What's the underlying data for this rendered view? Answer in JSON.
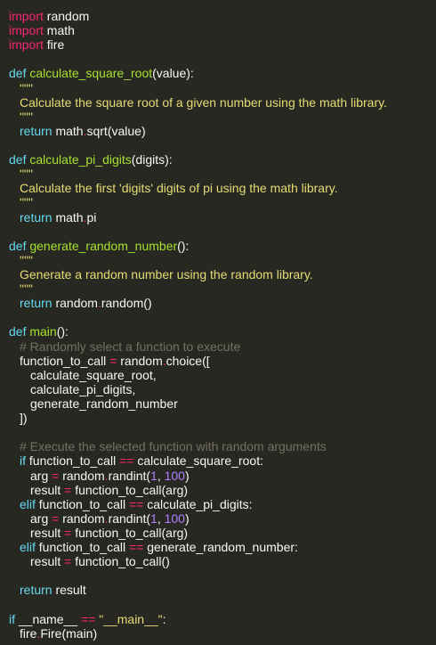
{
  "colors": {
    "background": "#272822",
    "keyword": "#f92672",
    "builtin": "#66d9ef",
    "function": "#a6e22e",
    "string": "#e6db74",
    "comment": "#75715e",
    "number": "#ae81ff",
    "text": "#f8f8f2"
  },
  "lines": [
    {
      "indent": 0,
      "tokens": [
        [
          "k",
          "import"
        ],
        [
          "p",
          " random"
        ]
      ]
    },
    {
      "indent": 0,
      "tokens": [
        [
          "k",
          "import"
        ],
        [
          "p",
          " math"
        ]
      ]
    },
    {
      "indent": 0,
      "tokens": [
        [
          "k",
          "import"
        ],
        [
          "p",
          " fire"
        ]
      ]
    },
    {
      "indent": 0,
      "tokens": []
    },
    {
      "indent": 0,
      "tokens": [
        [
          "b",
          "def"
        ],
        [
          "f",
          " calculate_square_root"
        ],
        [
          "p",
          "(value):"
        ]
      ]
    },
    {
      "indent": 1,
      "tokens": [
        [
          "s",
          "\"\"\""
        ]
      ]
    },
    {
      "indent": 1,
      "tokens": [
        [
          "s",
          "Calculate the square root of a given number using the math library."
        ]
      ]
    },
    {
      "indent": 1,
      "tokens": [
        [
          "s",
          "\"\"\""
        ]
      ]
    },
    {
      "indent": 1,
      "tokens": [
        [
          "b",
          "return"
        ],
        [
          "p",
          " math"
        ],
        [
          "o",
          "."
        ],
        [
          "p",
          "sqrt(value)"
        ]
      ]
    },
    {
      "indent": 0,
      "tokens": []
    },
    {
      "indent": 0,
      "tokens": [
        [
          "b",
          "def"
        ],
        [
          "f",
          " calculate_pi_digits"
        ],
        [
          "p",
          "(digits):"
        ]
      ]
    },
    {
      "indent": 1,
      "tokens": [
        [
          "s",
          "\"\"\""
        ]
      ]
    },
    {
      "indent": 1,
      "tokens": [
        [
          "s",
          "Calculate the first 'digits' digits of pi using the math library."
        ]
      ]
    },
    {
      "indent": 1,
      "tokens": [
        [
          "s",
          "\"\"\""
        ]
      ]
    },
    {
      "indent": 1,
      "tokens": [
        [
          "b",
          "return"
        ],
        [
          "p",
          " math"
        ],
        [
          "o",
          "."
        ],
        [
          "p",
          "pi"
        ]
      ]
    },
    {
      "indent": 0,
      "tokens": []
    },
    {
      "indent": 0,
      "tokens": [
        [
          "b",
          "def"
        ],
        [
          "f",
          " generate_random_number"
        ],
        [
          "p",
          "():"
        ]
      ]
    },
    {
      "indent": 1,
      "tokens": [
        [
          "s",
          "\"\"\""
        ]
      ]
    },
    {
      "indent": 1,
      "tokens": [
        [
          "s",
          "Generate a random number using the random library."
        ]
      ]
    },
    {
      "indent": 1,
      "tokens": [
        [
          "s",
          "\"\"\""
        ]
      ]
    },
    {
      "indent": 1,
      "tokens": [
        [
          "b",
          "return"
        ],
        [
          "p",
          " random"
        ],
        [
          "o",
          "."
        ],
        [
          "p",
          "random()"
        ]
      ]
    },
    {
      "indent": 0,
      "tokens": []
    },
    {
      "indent": 0,
      "tokens": [
        [
          "b",
          "def"
        ],
        [
          "f",
          " main"
        ],
        [
          "p",
          "():"
        ]
      ]
    },
    {
      "indent": 1,
      "tokens": [
        [
          "c",
          "# Randomly select a function to execute"
        ]
      ]
    },
    {
      "indent": 1,
      "tokens": [
        [
          "p",
          "function_to_call "
        ],
        [
          "o",
          "="
        ],
        [
          "p",
          " random"
        ],
        [
          "o",
          "."
        ],
        [
          "p",
          "choice(["
        ]
      ]
    },
    {
      "indent": 2,
      "tokens": [
        [
          "p",
          "calculate_square_root,"
        ]
      ]
    },
    {
      "indent": 2,
      "tokens": [
        [
          "p",
          "calculate_pi_digits,"
        ]
      ]
    },
    {
      "indent": 2,
      "tokens": [
        [
          "p",
          "generate_random_number"
        ]
      ]
    },
    {
      "indent": 1,
      "tokens": [
        [
          "p",
          "])"
        ]
      ]
    },
    {
      "indent": 0,
      "tokens": []
    },
    {
      "indent": 1,
      "tokens": [
        [
          "c",
          "# Execute the selected function with random arguments"
        ]
      ]
    },
    {
      "indent": 1,
      "tokens": [
        [
          "b",
          "if"
        ],
        [
          "p",
          " function_to_call "
        ],
        [
          "o",
          "=="
        ],
        [
          "p",
          " calculate_square_root:"
        ]
      ]
    },
    {
      "indent": 2,
      "tokens": [
        [
          "p",
          "arg "
        ],
        [
          "o",
          "="
        ],
        [
          "p",
          " random"
        ],
        [
          "o",
          "."
        ],
        [
          "p",
          "randint("
        ],
        [
          "n",
          "1"
        ],
        [
          "p",
          ", "
        ],
        [
          "n",
          "100"
        ],
        [
          "p",
          ")"
        ]
      ]
    },
    {
      "indent": 2,
      "tokens": [
        [
          "p",
          "result "
        ],
        [
          "o",
          "="
        ],
        [
          "p",
          " function_to_call(arg)"
        ]
      ]
    },
    {
      "indent": 1,
      "tokens": [
        [
          "b",
          "elif"
        ],
        [
          "p",
          " function_to_call "
        ],
        [
          "o",
          "=="
        ],
        [
          "p",
          " calculate_pi_digits:"
        ]
      ]
    },
    {
      "indent": 2,
      "tokens": [
        [
          "p",
          "arg "
        ],
        [
          "o",
          "="
        ],
        [
          "p",
          " random"
        ],
        [
          "o",
          "."
        ],
        [
          "p",
          "randint("
        ],
        [
          "n",
          "1"
        ],
        [
          "p",
          ", "
        ],
        [
          "n",
          "100"
        ],
        [
          "p",
          ")"
        ]
      ]
    },
    {
      "indent": 2,
      "tokens": [
        [
          "p",
          "result "
        ],
        [
          "o",
          "="
        ],
        [
          "p",
          " function_to_call(arg)"
        ]
      ]
    },
    {
      "indent": 1,
      "tokens": [
        [
          "b",
          "elif"
        ],
        [
          "p",
          " function_to_call "
        ],
        [
          "o",
          "=="
        ],
        [
          "p",
          " generate_random_number:"
        ]
      ]
    },
    {
      "indent": 2,
      "tokens": [
        [
          "p",
          "result "
        ],
        [
          "o",
          "="
        ],
        [
          "p",
          " function_to_call()"
        ]
      ]
    },
    {
      "indent": 0,
      "tokens": []
    },
    {
      "indent": 1,
      "tokens": [
        [
          "b",
          "return"
        ],
        [
          "p",
          " result"
        ]
      ]
    },
    {
      "indent": 0,
      "tokens": []
    },
    {
      "indent": 0,
      "tokens": [
        [
          "b",
          "if"
        ],
        [
          "p",
          " __name__ "
        ],
        [
          "o",
          "=="
        ],
        [
          "s",
          " \"__main__\""
        ],
        [
          "p",
          ":"
        ]
      ]
    },
    {
      "indent": 1,
      "tokens": [
        [
          "p",
          "fire"
        ],
        [
          "o",
          "."
        ],
        [
          "p",
          "Fire(main)"
        ]
      ]
    }
  ]
}
